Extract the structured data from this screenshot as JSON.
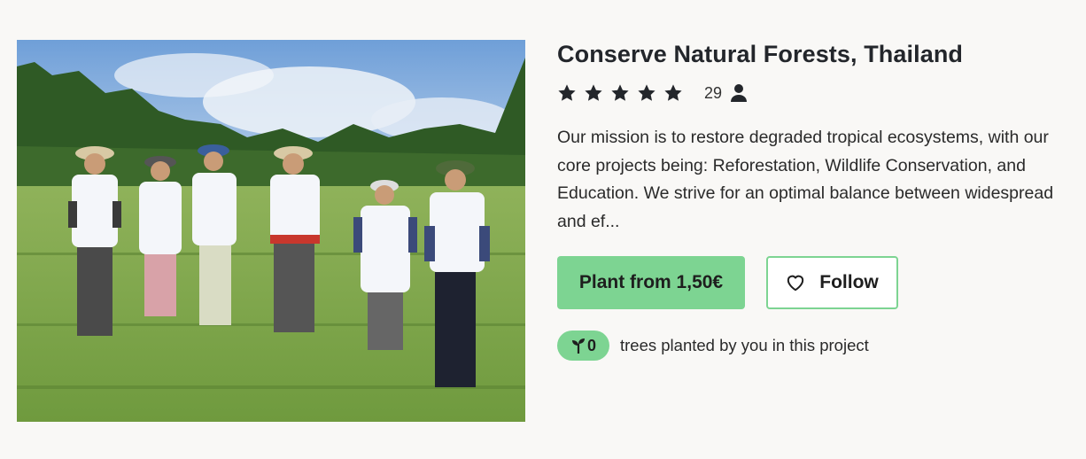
{
  "project": {
    "title": "Conserve Natural Forests, Thailand",
    "rating_stars": 5,
    "rating_count": "29",
    "description": "Our mission is to restore degraded tropical ecosystems, with our core projects being: Reforestation, Wildlife Conservation, and Education. We strive for an optimal balance between widespread and ef...",
    "image_alt": "Group of volunteers holding seedlings in a field"
  },
  "actions": {
    "plant_label": "Plant from 1,50€",
    "follow_label": "Follow"
  },
  "planted": {
    "count": "0",
    "text": "trees planted by you in this project"
  },
  "colors": {
    "accent": "#7dd492",
    "background": "#f9f8f6",
    "title": "#23262b"
  },
  "icons": {
    "star": "star-icon",
    "person": "person-icon",
    "heart": "heart-icon",
    "sprout": "sprout-icon"
  }
}
